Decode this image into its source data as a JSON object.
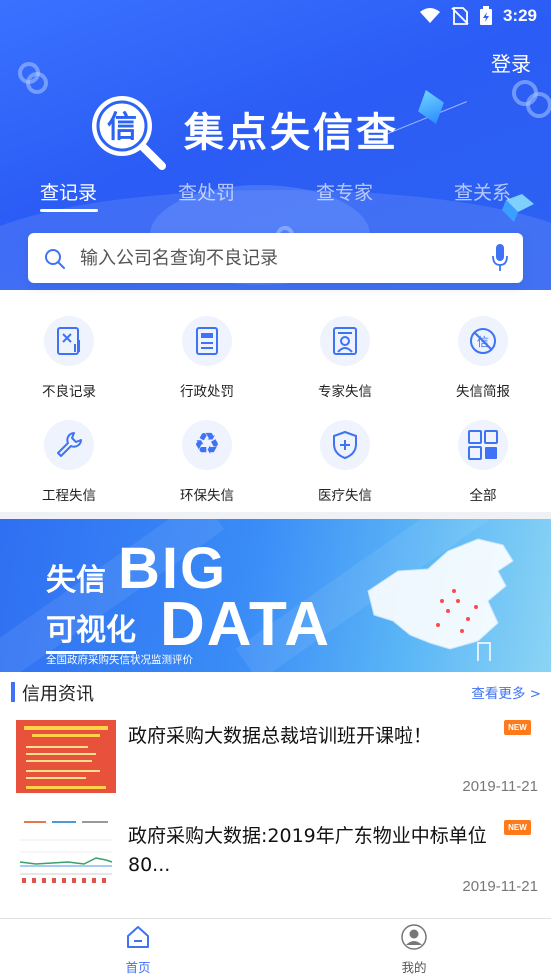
{
  "status_bar": {
    "time": "3:29"
  },
  "header": {
    "login_label": "登录",
    "app_title": "集点失信查",
    "logo_char": "信",
    "tabs": [
      {
        "label": "查记录",
        "active": true
      },
      {
        "label": "查处罚",
        "active": false
      },
      {
        "label": "查专家",
        "active": false
      },
      {
        "label": "查关系",
        "active": false
      }
    ],
    "search": {
      "placeholder": "输入公司名查询不良记录"
    }
  },
  "grid": {
    "items": [
      {
        "label": "不良记录",
        "icon": "bad-record-icon"
      },
      {
        "label": "行政处罚",
        "icon": "penalty-document-icon"
      },
      {
        "label": "专家失信",
        "icon": "expert-icon"
      },
      {
        "label": "失信简报",
        "icon": "credit-report-icon"
      },
      {
        "label": "工程失信",
        "icon": "wrench-icon"
      },
      {
        "label": "环保失信",
        "icon": "recycle-icon"
      },
      {
        "label": "医疗失信",
        "icon": "medical-shield-icon"
      },
      {
        "label": "全部",
        "icon": "all-grid-icon"
      }
    ]
  },
  "banner": {
    "cn_line1": "失信",
    "cn_line2": "可视化",
    "en_line1": "BIG",
    "en_line2": "DATA",
    "subtitle": "全国政府采购失信状况监测评价"
  },
  "news": {
    "section_title": "信用资讯",
    "more_label": "查看更多 >",
    "items": [
      {
        "headline": "政府采购大数据总裁培训班开课啦！",
        "date": "2019-11-21",
        "badge": "NEW"
      },
      {
        "headline": "政府采购大数据:2019年广东物业中标单位80...",
        "date": "2019-11-21",
        "badge": "NEW"
      }
    ]
  },
  "bottom_nav": {
    "items": [
      {
        "label": "首页",
        "active": true
      },
      {
        "label": "我的",
        "active": false
      }
    ]
  },
  "colors": {
    "primary": "#3f73f5",
    "header_bg": "#2d63f2",
    "badge": "#ff7a1a"
  }
}
